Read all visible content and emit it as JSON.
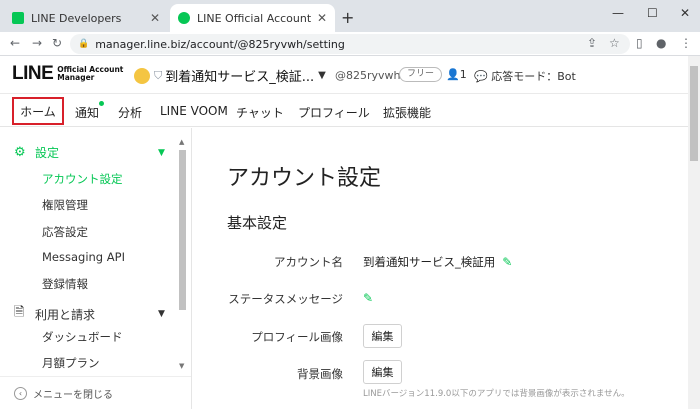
{
  "browser": {
    "tabs": [
      {
        "label": "LINE Developers"
      },
      {
        "label": "LINE Official Account Manager"
      }
    ],
    "url": "manager.line.biz/account/@825ryvwh/setting"
  },
  "header": {
    "logo_main": "LINE",
    "logo_sub1": "Official Account",
    "logo_sub2": "Manager",
    "account_name": "到着通知サービス_検証...",
    "account_id": "@825ryvwh",
    "plan": "フリー",
    "member_count": "1",
    "response_mode": "応答モード：Bot"
  },
  "nav": {
    "items": [
      "ホーム",
      "通知",
      "分析",
      "LINE VOOM",
      "チャット",
      "プロフィール",
      "拡張機能"
    ]
  },
  "sidebar": {
    "group_settings": "設定",
    "settings_items": [
      "アカウント設定",
      "権限管理",
      "応答設定",
      "Messaging API",
      "登録情報"
    ],
    "group_billing": "利用と請求",
    "billing_items": [
      "ダッシュボード",
      "月額プラン"
    ],
    "close_menu": "メニューを閉じる"
  },
  "content": {
    "title": "アカウント設定",
    "section": "基本設定",
    "rows": [
      {
        "label": "アカウント名",
        "value": "到着通知サービス_検証用"
      },
      {
        "label": "ステータスメッセージ",
        "value": ""
      },
      {
        "label": "プロフィール画像",
        "button": "編集"
      },
      {
        "label": "背景画像",
        "button": "編集"
      }
    ],
    "note": "LINEバージョン11.9.0以下のアプリでは背景画像が表示されません。"
  },
  "colors": {
    "accent": "#06c755",
    "highlight_box": "#d8202a"
  }
}
